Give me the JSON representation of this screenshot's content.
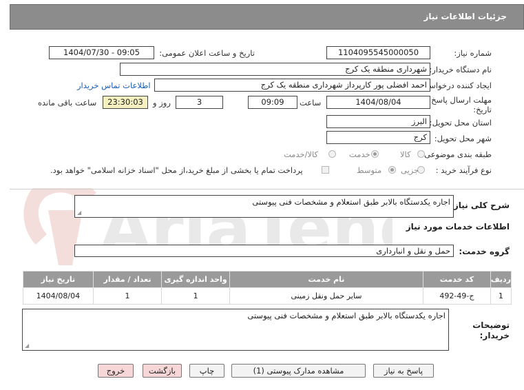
{
  "header": {
    "title": "جزئیات اطلاعات نیاز"
  },
  "fields": {
    "need_number_label": "شماره نیاز:",
    "need_number": "1104095545000050",
    "announce_label": "تاریخ و ساعت اعلان عمومی:",
    "announce_value": "1404/07/30 - 09:05",
    "buyer_label": "نام دستگاه خریدار:",
    "buyer_value": "شهرداری منطقه یک کرج",
    "requester_label": "ایجاد کننده درخواست:",
    "requester_value": "احمد افضلی پور کارپرداز شهرداری منطقه یک کرج",
    "contact_link": "اطلاعات تماس خریدار",
    "deadline_label_1": "مهلت ارسال پاسخ: تا",
    "deadline_label_2": "تاریخ:",
    "deadline_date": "1404/08/04",
    "time_label": "ساعت",
    "deadline_time": "09:09",
    "days_value": "3",
    "days_label": "روز و",
    "remaining_time": "23:30:03",
    "remaining_label": "ساعت باقی مانده",
    "province_label": "استان محل تحویل:",
    "province_value": "البرز",
    "city_label": "شهر محل تحویل:",
    "city_value": "کرج",
    "category_label": "طبقه بندی موضوعی:",
    "category_options": [
      "کالا",
      "خدمت",
      "کالا/خدمت"
    ],
    "category_selected": "خدمت",
    "process_label": "نوع فرآیند خرید :",
    "process_options": [
      "جزیی",
      "متوسط"
    ],
    "process_selected": "متوسط",
    "payment_note": "پرداخت تمام یا بخشی از مبلغ خرید،از محل \"اسناد خزانه اسلامی\" خواهد بود."
  },
  "description": {
    "label": "شرح کلی نیاز:",
    "value": "اجاره یکدستگاه بالابر  طبق استعلام و مشخصات فنی پیوستی"
  },
  "services_section": {
    "title": "اطلاعات خدمات مورد نیاز",
    "group_label": "گروه خدمت:",
    "group_value": "حمل و نقل و انبارداری"
  },
  "table": {
    "headers": [
      "ردیف",
      "کد خدمت",
      "نام خدمت",
      "واحد اندازه گیری",
      "تعداد / مقدار",
      "تاریخ نیاز"
    ],
    "rows": [
      [
        "1",
        "ج-49-492",
        "سایر حمل ونقل زمینی",
        "1",
        "1",
        "1404/08/04"
      ]
    ]
  },
  "buyer_notes": {
    "label_1": "توضیحات",
    "label_2": "خریدار:",
    "value": "اجاره یکدستگاه بالابر  طبق استعلام و مشخصات فنی پیوستی"
  },
  "buttons": {
    "reply": "پاسخ به نیاز",
    "attachments": "مشاهده مدارک پیوستی (1)",
    "print": "چاپ",
    "back": "بازگشت",
    "exit": "خروج"
  },
  "watermark": {
    "text": "AriaTender.neT"
  },
  "colors": {
    "header_bg": "#8c8c8c",
    "table_header_bg": "#9a9a9a",
    "remaining_bg": "#f4f0c0",
    "link": "#1a5fb4"
  }
}
